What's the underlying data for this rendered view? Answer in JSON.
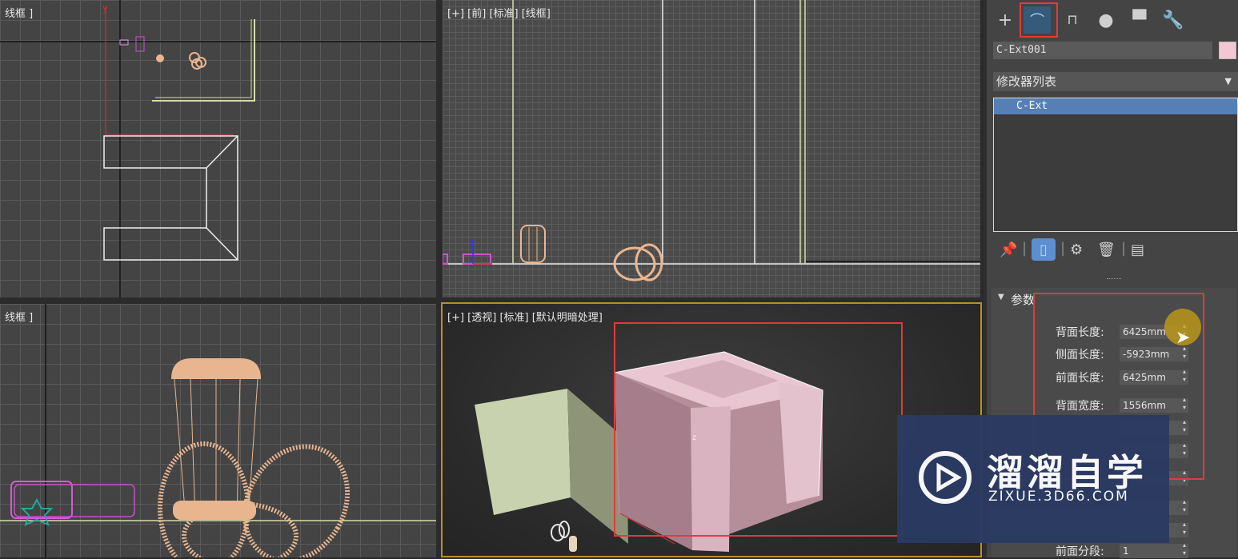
{
  "viewports": {
    "top": {
      "label": "线框 ]"
    },
    "front": {
      "label": "[+] [前] [标准] [线框]"
    },
    "left": {
      "label": "线框 ]"
    },
    "perspective": {
      "label": "[+] [透视] [标准] [默认明暗处理]"
    }
  },
  "panel": {
    "tabs": [
      {
        "name": "create",
        "icon": "plus-icon"
      },
      {
        "name": "modify",
        "icon": "modify-icon",
        "selected": true
      },
      {
        "name": "hierarchy",
        "icon": "hierarchy-icon"
      },
      {
        "name": "motion",
        "icon": "motion-icon"
      },
      {
        "name": "display",
        "icon": "display-icon"
      },
      {
        "name": "utilities",
        "icon": "wrench-icon"
      }
    ],
    "object_name": "C-Ext001",
    "object_color": "#f3c6d3",
    "modifier_list": "修改器列表",
    "modifier_stack": [
      "C-Ext"
    ],
    "rollout_title": "参数",
    "params": [
      {
        "label": "背面长度:",
        "value": "6425mm"
      },
      {
        "label": "侧面长度:",
        "value": "-5923mm"
      },
      {
        "label": "前面长度:",
        "value": "6425mm"
      },
      {
        "label": "背面宽度:",
        "value": "1556mm"
      },
      {
        "label": "前面分段:",
        "value": "1"
      }
    ]
  },
  "watermark": {
    "title": "溜溜自学",
    "url": "ZIXUE.3D66.COM"
  }
}
